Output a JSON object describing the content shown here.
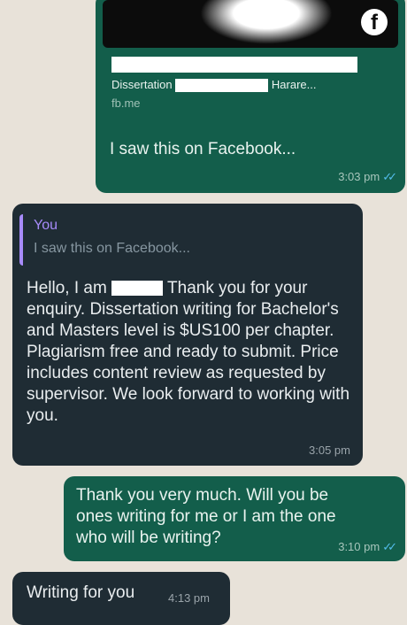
{
  "chat": {
    "link_preview": {
      "site_line": "Dissertation",
      "site_line_end": "Harare...",
      "domain": "fb.me",
      "brand_icon": "facebook-icon"
    },
    "msg1": {
      "text": "I saw this on Facebook...",
      "time": "3:03 pm",
      "status_icon": "double-check-icon"
    },
    "msg2": {
      "reply_sender": "You",
      "reply_text": "I saw this on Facebook...",
      "line1_a": "Hello, I am",
      "line1_b": "Thank you for",
      "rest": "your enquiry. Dissertation writing for Bachelor's and Masters level is $US100 per chapter. Plagiarism free and ready to submit. Price includes content review as requested by supervisor. We look forward to working with you.",
      "time": "3:05 pm"
    },
    "msg3": {
      "text": "Thank you very much. Will you be ones writing for me or I am the one who will be writing?",
      "time": "3:10 pm",
      "status_icon": "double-check-icon"
    },
    "msg4": {
      "text": "Writing for you",
      "time": "4:13 pm"
    }
  },
  "colors": {
    "background": "#e8e2d9",
    "outgoing_bubble": "#135e4b",
    "incoming_bubble": "#1f2c34",
    "reply_accent": "#a78bfa",
    "read_ticks": "#53bdeb"
  }
}
